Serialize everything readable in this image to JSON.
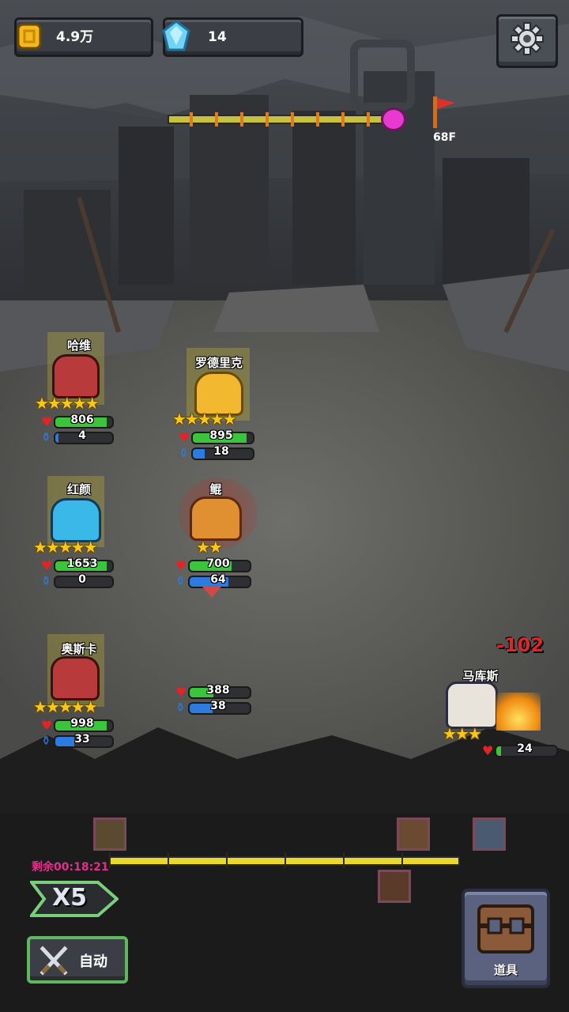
{
  "hud": {
    "gold": "4.9万",
    "gems": "14",
    "floor": "68F"
  },
  "heroes": [
    {
      "name": "哈维",
      "hp": "806",
      "mp": "4",
      "stars": "★★★★★",
      "hp_pct": 0.9,
      "mp_pct": 0.05
    },
    {
      "name": "罗德里克",
      "hp": "895",
      "mp": "18",
      "stars": "★★★★★",
      "hp_pct": 0.9,
      "mp_pct": 0.2
    },
    {
      "name": "红颜",
      "hp": "1653",
      "mp": "0",
      "stars": "★★★★★",
      "hp_pct": 0.9,
      "mp_pct": 0.0
    },
    {
      "name": "鲲",
      "hp": "700",
      "mp": "64",
      "stars": "★★",
      "hp_pct": 0.7,
      "mp_pct": 0.64
    },
    {
      "name": "奥斯卡",
      "hp": "998",
      "mp": "33",
      "stars": "★★★★★",
      "hp_pct": 0.9,
      "mp_pct": 0.33
    },
    {
      "name": "",
      "hp": "388",
      "mp": "38",
      "stars": "",
      "hp_pct": 0.4,
      "mp_pct": 0.38
    }
  ],
  "enemy": {
    "name": "马库斯",
    "hp": "24",
    "stars": "★★★",
    "hp_pct": 0.08,
    "damage": "-102"
  },
  "battle": {
    "remaining_label": "剩余00:18:21",
    "speed_label": "X5",
    "auto_label": "自动",
    "item_label": "道具"
  },
  "colors": {
    "hp": "#3cc43c",
    "mp": "#2e7be0",
    "damage": "#e0242a",
    "star": "#f6c81e"
  },
  "icons": [
    "gold-coin-icon",
    "diamond-icon",
    "settings-gear-icon",
    "boss-skull-icon",
    "flag-icon",
    "crossed-swords-icon",
    "treasure-chest-icon"
  ]
}
